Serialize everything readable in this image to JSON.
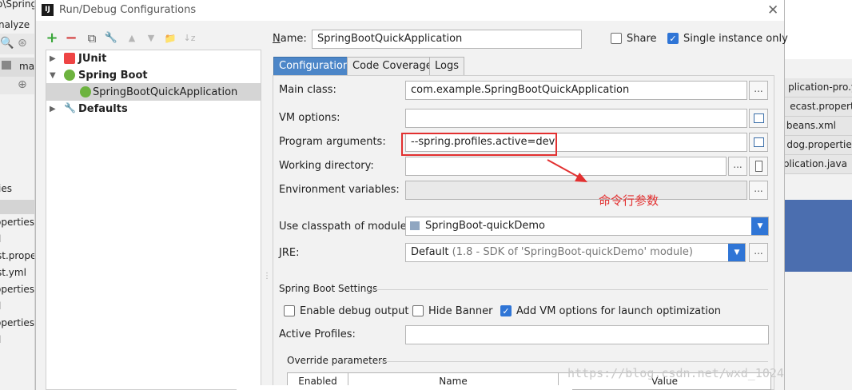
{
  "background_ide": {
    "left_fragments": [
      "o\\Spring",
      "nalyze",
      "ma",
      "ies",
      "operties",
      "l",
      "st.prope",
      "st.yml",
      "operties",
      "l",
      "operties",
      "l"
    ],
    "right_tabs": [
      "plication-pro.y",
      "ecast.properti",
      "beans.xml",
      "dog.properties",
      "plication.java"
    ]
  },
  "dialog": {
    "title": "Run/Debug Configurations",
    "title_icon_text": "IJ",
    "close_glyph": "✕"
  },
  "toolbar": {
    "add": "+",
    "remove": "−",
    "copy": "⧉",
    "wrench": "🔧",
    "up": "▲",
    "down": "▼",
    "folder": "📁",
    "sort": "↓z"
  },
  "tree": {
    "items": [
      {
        "label": "JUnit",
        "bold": true,
        "icon": "junit-icon"
      },
      {
        "label": "Spring Boot",
        "bold": true,
        "icon": "spring-boot-icon"
      },
      {
        "label": "SpringBootQuickApplication",
        "bold": false,
        "icon": "spring-boot-app-icon",
        "selected": true
      },
      {
        "label": "Defaults",
        "bold": true,
        "icon": "defaults-wrench-icon"
      }
    ]
  },
  "form": {
    "name_label": "Name:",
    "name_value": "SpringBootQuickApplication",
    "share_label": "Share",
    "share_checked": false,
    "single_instance_label": "Single instance only",
    "single_instance_checked": true,
    "tabs": [
      "Configuration",
      "Code Coverage",
      "Logs"
    ],
    "active_tab": "Configuration",
    "main_class_label": "Main class:",
    "main_class_value": "com.example.SpringBootQuickApplication",
    "vm_options_label": "VM options:",
    "vm_options_value": "",
    "program_args_label": "Program arguments:",
    "program_args_value": "--spring.profiles.active=dev",
    "working_dir_label": "Working directory:",
    "working_dir_value": "",
    "env_vars_label": "Environment variables:",
    "env_vars_value": "",
    "classpath_label": "Use classpath of module:",
    "classpath_value": "SpringBoot-quickDemo",
    "jre_label": "JRE:",
    "jre_value": "Default",
    "jre_detail": "(1.8 - SDK of 'SpringBoot-quickDemo' module)",
    "spring_settings_label": "Spring Boot Settings",
    "enable_debug_label": "Enable debug output",
    "enable_debug_checked": false,
    "hide_banner_label": "Hide Banner",
    "hide_banner_checked": false,
    "add_vm_label": "Add VM options for launch optimization",
    "add_vm_checked": true,
    "active_profiles_label": "Active Profiles:",
    "active_profiles_value": "",
    "override_label": "Override parameters",
    "table_headers": [
      "Enabled",
      "Name",
      "Value"
    ],
    "dots": "..."
  },
  "annotation": {
    "text": "命令行参数",
    "color": "#e23030"
  },
  "watermark": "https://blog.csdn.net/wxd_1024",
  "colors": {
    "accent": "#2f75d6",
    "tab_active": "#4c86c8",
    "annotation_red": "#e23030"
  }
}
